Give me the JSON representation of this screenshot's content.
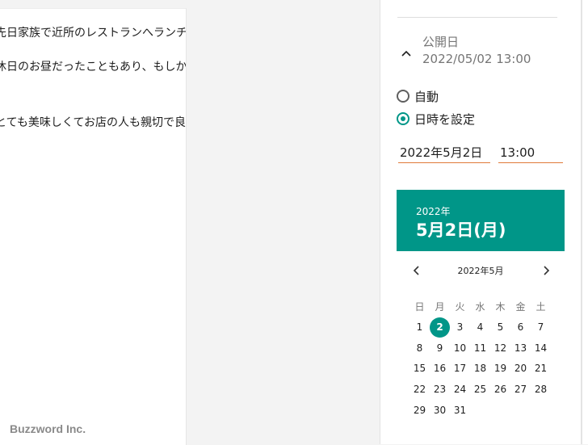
{
  "editor": {
    "paragraphs": [
      "先日家族で近所のレストランへランチに行ってきました。",
      "休日のお昼だったこともあり、もしかしたら店内は満席になって",
      "とても美味しくてお店の人も親切で良かったです。また違う日に来て"
    ],
    "watermark": "Buzzword Inc."
  },
  "sidebar": {
    "publish": {
      "label": "公開日",
      "value": "2022/05/02 13:00",
      "icon": "chevron-up-icon"
    },
    "radios": [
      {
        "label": "自動",
        "checked": false
      },
      {
        "label": "日時を設定",
        "checked": true
      }
    ],
    "date_value": "2022年5月2日",
    "time_value": "13:00",
    "calendar": {
      "year": "2022年",
      "selected_date": "5月2日(月)",
      "month_label": "2022年5月",
      "weekdays": [
        "日",
        "月",
        "火",
        "水",
        "木",
        "金",
        "土"
      ],
      "days": [
        "1",
        "2",
        "3",
        "4",
        "5",
        "6",
        "7",
        "8",
        "9",
        "10",
        "11",
        "12",
        "13",
        "14",
        "15",
        "16",
        "17",
        "18",
        "19",
        "20",
        "21",
        "22",
        "23",
        "24",
        "25",
        "26",
        "27",
        "28",
        "29",
        "30",
        "31"
      ],
      "selected_day": "2",
      "start_weekday": 0
    },
    "colors": {
      "accent": "#009688",
      "underline": "#e07b39"
    }
  }
}
